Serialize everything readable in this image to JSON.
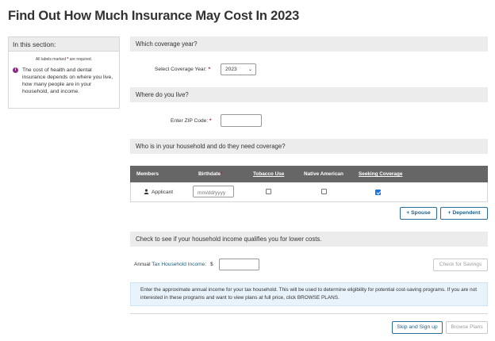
{
  "page_title": "Find Out How Much Insurance May Cost In 2023",
  "sidebar": {
    "heading": "In this section:",
    "required_note_prefix": "All labels marked",
    "required_star": "*",
    "required_note_suffix": "are required.",
    "info_icon_glyph": "i",
    "info_text": "The cost of health and dental insurance depends on where you live, how many people are in your household, and income."
  },
  "coverage": {
    "heading": "Which coverage year?",
    "label": "Select Coverage Year:",
    "star": "*",
    "selected": "2023",
    "chevron": "⌄"
  },
  "location": {
    "heading": "Where do you live?",
    "zip_label": "Enter ZIP Code:",
    "star": "*",
    "zip_value": ""
  },
  "household": {
    "heading": "Who is in your household and do they need coverage?",
    "columns": {
      "members": "Members",
      "birthdate": "Birthdate",
      "birthdate_star": "*",
      "tobacco": "Tobacco Use",
      "native": "Native American",
      "seeking": "Seeking Coverage"
    },
    "row": {
      "member": "Applicant",
      "birthdate_placeholder": "mm/dd/yyyy",
      "tobacco": false,
      "native": false,
      "seeking": true
    },
    "add_spouse": "+ Spouse",
    "add_dependent": "+ Dependent"
  },
  "income": {
    "heading": "Check to see if your household income qualifies you for lower costs.",
    "label_prefix": "Annual ",
    "label_bold": "Tax Household Income",
    "label_suffix": ":",
    "currency": "$",
    "value": "",
    "check_button": "Check for Savings",
    "note": "Enter the approximate annual income for your tax household. This will be used to determine eligibility for potential cost-saving programs. If you are not interested in these programs and want to view plans at full price, click BROWSE PLANS."
  },
  "footer": {
    "skip_button": "Skip and Sign up",
    "browse_button": "Browse Plans"
  },
  "colors": {
    "required": "#c8102e",
    "accent": "#1d5f86",
    "table_header": "#666666",
    "info_icon": "#8a2c82"
  }
}
